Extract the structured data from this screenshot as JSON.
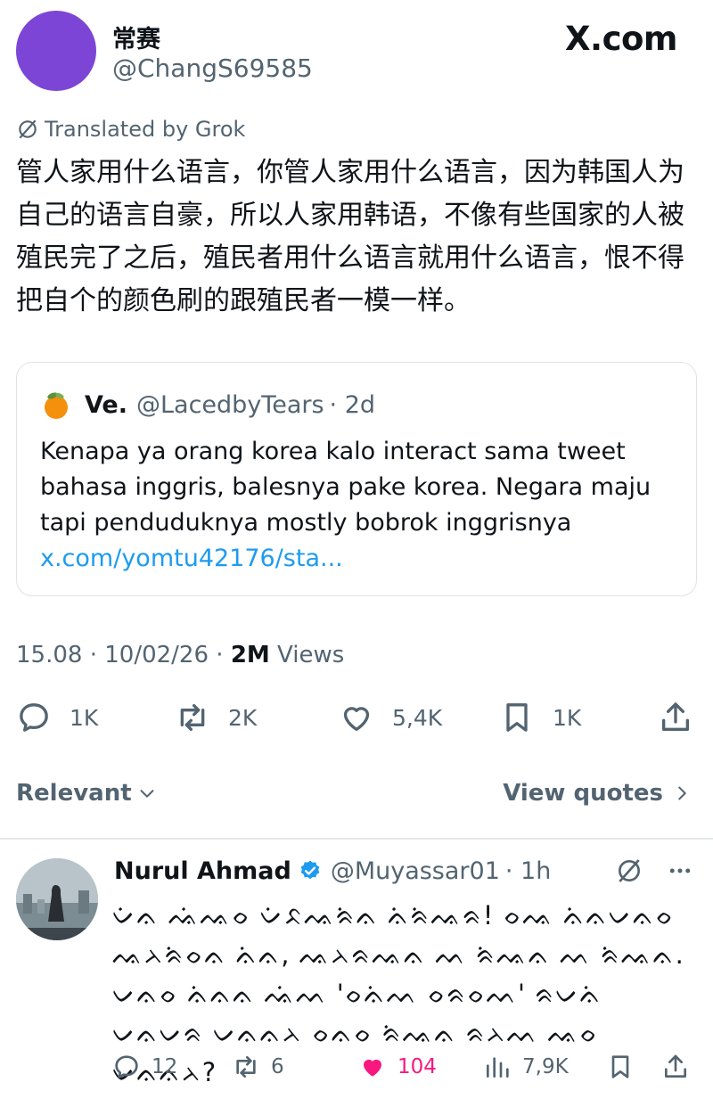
{
  "author": {
    "name": "常赛",
    "handle": "@ChangS69585"
  },
  "site_label": "X.com",
  "translated_label": "Translated by Grok",
  "tweet_text": "管人家用什么语言，你管人家用什么语言，因为韩国人为自己的语言自豪，所以人家用韩语，不像有些国家的人被殖民完了之后，殖民者用什么语言就用什么语言，恨不得把自个的颜色刷的跟殖民者一模一样。",
  "quote": {
    "name": "Ve.",
    "handle": "@LacedbyTears",
    "time": "· 2d",
    "text": "Kenapa ya orang korea kalo interact sama tweet bahasa inggris, balesnya pake korea. Negara maju tapi penduduknya mostly bobrok inggrisnya ",
    "link": "x.com/yomtu42176/sta..."
  },
  "meta": {
    "time": "15.08",
    "date": "10/02/26",
    "views_count": "2M",
    "views_label": "Views",
    "sep": "·"
  },
  "actions": {
    "replies": "1K",
    "reposts": "2K",
    "likes": "5,4K",
    "bookmarks": "1K"
  },
  "sort_label": "Relevant",
  "view_quotes_label": "View quotes",
  "reply": {
    "name": "Nurul Ahmad",
    "handle": "@Muyassar01",
    "time": "· 1h",
    "text": "ᨆᨗᨊ ᨕᨗᨕᨔ ᨆᨗᨅᨕᨑᨗᨊ ᨊᨗᨑᨗᨕᨑ! ᨔᨕ ᨊᨗᨊᨆᨊᨔ ᨕᨂᨑᨗᨔᨊ ᨊᨗᨊ, ᨕᨂᨑᨕᨊ ᨓ ᨑᨗᨕᨊ ᨓ ᨑᨗᨕᨊ. ᨆᨊᨔ ᨊᨗᨊᨊ ᨕᨗᨓ 'ᨔᨊᨗᨓ ᨔᨑᨔᨓ' ᨑᨆᨊᨗ ᨆᨊᨆᨑ ᨆᨊᨊᨂ ᨔᨊᨔ ᨑᨗᨕᨊ ᨑᨂᨓ ᨕᨔ ᨆᨊᨊᨂ?",
    "replies": "12",
    "reposts": "6",
    "likes": "104",
    "views": "7,9K"
  },
  "colors": {
    "accent": "#1d9bf0",
    "like": "#f91880",
    "muted": "#536471",
    "avatar": "#7c45d6"
  }
}
